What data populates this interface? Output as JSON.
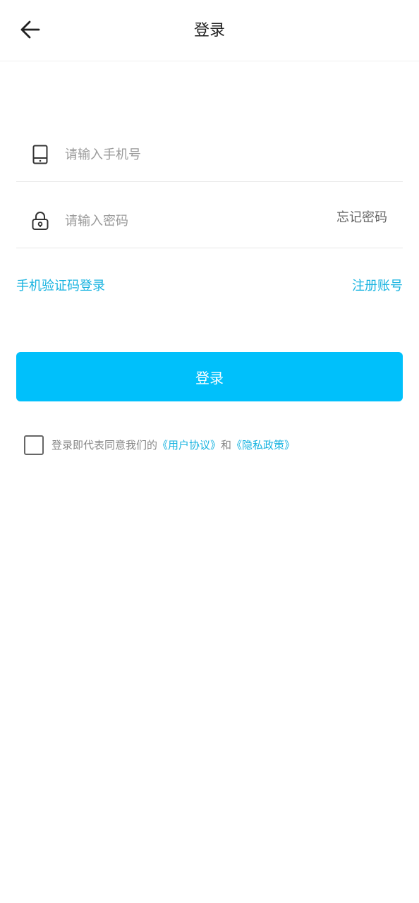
{
  "header": {
    "title": "登录",
    "back_icon": "arrow-left-icon"
  },
  "form": {
    "phone": {
      "icon": "phone-icon",
      "placeholder": "请输入手机号",
      "value": ""
    },
    "password": {
      "icon": "lock-icon",
      "placeholder": "请输入密码",
      "value": "",
      "forgot_label": "忘记密码"
    }
  },
  "links": {
    "sms_login": "手机验证码登录",
    "register": "注册账号"
  },
  "login_button": {
    "label": "登录"
  },
  "agreement": {
    "checked": false,
    "prefix": "登录即代表同意我们的",
    "user_agreement": "《用户协议》",
    "conjunction": "和",
    "privacy_policy": "《隐私政策》"
  },
  "colors": {
    "accent": "#00c0fb",
    "link": "#17b3e0",
    "placeholder": "#9a9a9a",
    "divider": "#e8e8e8"
  }
}
